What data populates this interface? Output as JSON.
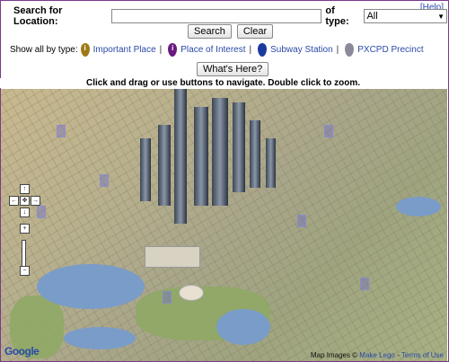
{
  "help_link": "[Help]",
  "search": {
    "label": "Search for Location:",
    "value": "",
    "type_label": "of type:",
    "type_value": "All"
  },
  "buttons": {
    "search": "Search",
    "clear": "Clear",
    "whats_here": "What's Here?"
  },
  "show_all": {
    "label": "Show all by type:",
    "items": [
      {
        "label": "Important Place",
        "icon": "gold-pin-icon",
        "color": "#a07a18"
      },
      {
        "label": "Place of Interest",
        "icon": "purple-pin-icon",
        "color": "#6a1a80"
      },
      {
        "label": "Subway Station",
        "icon": "blue-pin-icon",
        "color": "#1a3aa0"
      },
      {
        "label": "PXCPD Precinct",
        "icon": "gray-pin-icon",
        "color": "#8a8a9a"
      }
    ],
    "separator": "|"
  },
  "instruction": "Click and drag or use buttons to navigate. Double click to zoom.",
  "map": {
    "controls": {
      "up": "↑",
      "left": "←",
      "center": "✥",
      "right": "→",
      "down": "↓",
      "zoom_in": "+",
      "zoom_out": "−"
    },
    "footer": {
      "prefix": "Map Images ©",
      "link1": "Make Lego",
      "sep": "-",
      "link2": "Terms of Use"
    },
    "logo": "Google"
  }
}
